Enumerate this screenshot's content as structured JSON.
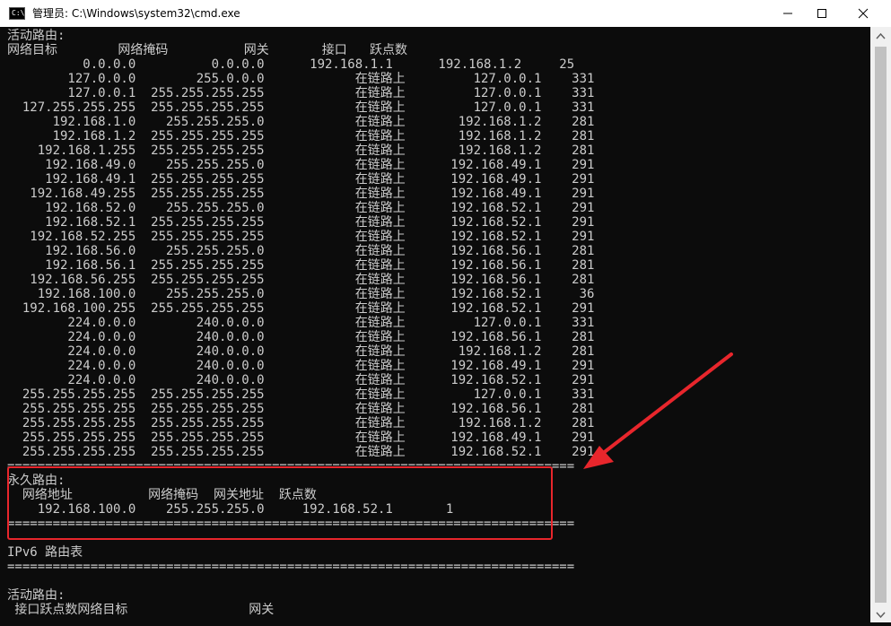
{
  "window": {
    "title": "管理员: C:\\Windows\\system32\\cmd.exe",
    "icon_text": "C:\\",
    "minimize_icon": "minimize-icon",
    "maximize_icon": "maximize-icon",
    "close_icon": "close-icon"
  },
  "console": {
    "lines": [
      "活动路由:",
      "网络目标        网络掩码          网关       接口   跃点数",
      "          0.0.0.0          0.0.0.0      192.168.1.1      192.168.1.2     25",
      "        127.0.0.0        255.0.0.0            在链路上         127.0.0.1    331",
      "        127.0.0.1  255.255.255.255            在链路上         127.0.0.1    331",
      "  127.255.255.255  255.255.255.255            在链路上         127.0.0.1    331",
      "      192.168.1.0    255.255.255.0            在链路上       192.168.1.2    281",
      "      192.168.1.2  255.255.255.255            在链路上       192.168.1.2    281",
      "    192.168.1.255  255.255.255.255            在链路上       192.168.1.2    281",
      "     192.168.49.0    255.255.255.0            在链路上      192.168.49.1    291",
      "     192.168.49.1  255.255.255.255            在链路上      192.168.49.1    291",
      "   192.168.49.255  255.255.255.255            在链路上      192.168.49.1    291",
      "     192.168.52.0    255.255.255.0            在链路上      192.168.52.1    291",
      "     192.168.52.1  255.255.255.255            在链路上      192.168.52.1    291",
      "   192.168.52.255  255.255.255.255            在链路上      192.168.52.1    291",
      "     192.168.56.0    255.255.255.0            在链路上      192.168.56.1    281",
      "     192.168.56.1  255.255.255.255            在链路上      192.168.56.1    281",
      "   192.168.56.255  255.255.255.255            在链路上      192.168.56.1    281",
      "    192.168.100.0    255.255.255.0            在链路上      192.168.52.1     36",
      "  192.168.100.255  255.255.255.255            在链路上      192.168.52.1    291",
      "        224.0.0.0        240.0.0.0            在链路上         127.0.0.1    331",
      "        224.0.0.0        240.0.0.0            在链路上      192.168.56.1    281",
      "        224.0.0.0        240.0.0.0            在链路上       192.168.1.2    281",
      "        224.0.0.0        240.0.0.0            在链路上      192.168.49.1    291",
      "        224.0.0.0        240.0.0.0            在链路上      192.168.52.1    291",
      "  255.255.255.255  255.255.255.255            在链路上         127.0.0.1    331",
      "  255.255.255.255  255.255.255.255            在链路上      192.168.56.1    281",
      "  255.255.255.255  255.255.255.255            在链路上       192.168.1.2    281",
      "  255.255.255.255  255.255.255.255            在链路上      192.168.49.1    291",
      "  255.255.255.255  255.255.255.255            在链路上      192.168.52.1    291",
      "===========================================================================",
      "永久路由:",
      "  网络地址          网络掩码  网关地址  跃点数",
      "    192.168.100.0    255.255.255.0     192.168.52.1       1",
      "===========================================================================",
      "",
      "IPv6 路由表",
      "===========================================================================",
      "",
      "活动路由:",
      " 接口跃点数网络目标                网关"
    ]
  },
  "annotation": {
    "box_color": "#e8262c",
    "arrow_color": "#e8262c"
  }
}
